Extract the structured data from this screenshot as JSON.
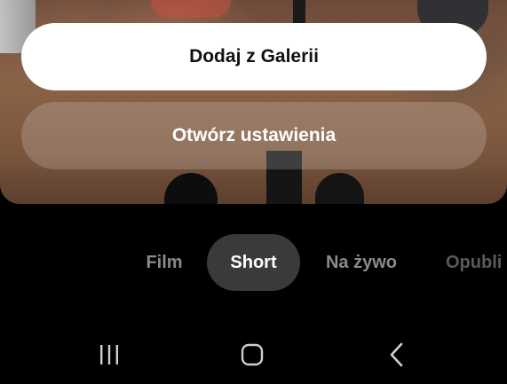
{
  "dialog": {
    "gallery_button": "Dodaj z Galerii",
    "settings_button": "Otwórz ustawienia"
  },
  "modes": {
    "film": "Film",
    "short": "Short",
    "live": "Na żywo",
    "publish": "Opubli",
    "selected": "Short"
  },
  "nav": {
    "recent_icon": "recent-apps-icon",
    "home_icon": "home-icon",
    "back_icon": "back-icon"
  },
  "colors": {
    "background": "#000000",
    "primary_button": "#ffffff",
    "selected_mode": "#3a3a3a",
    "inactive_text": "#8a8a8a"
  }
}
